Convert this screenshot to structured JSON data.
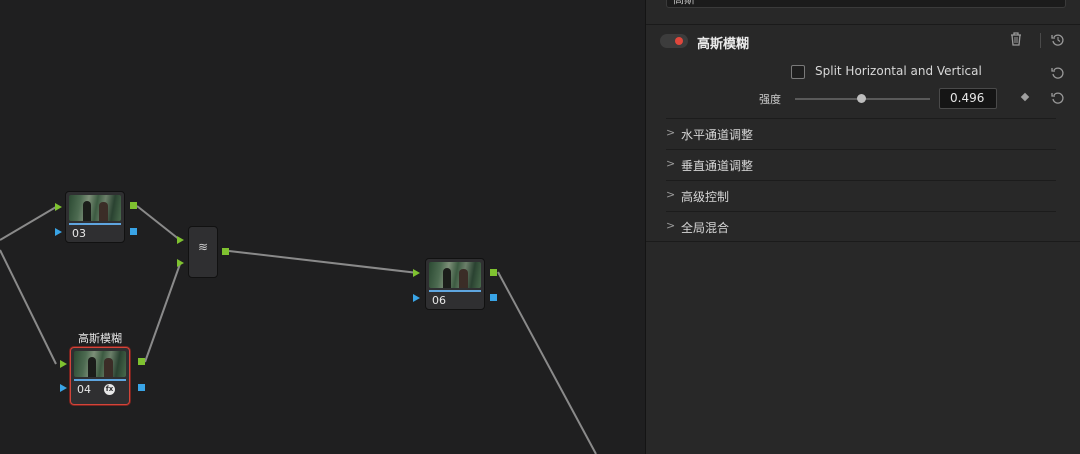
{
  "graph": {
    "nodes": [
      {
        "id": "03",
        "label": "03"
      },
      {
        "id": "04",
        "label": "04",
        "title": "高斯模糊",
        "fx_badge": "fx"
      },
      {
        "id": "06",
        "label": "06"
      }
    ],
    "mixer_glyph": "≋"
  },
  "inspector": {
    "search_value": "高斯",
    "search_clear": "✕",
    "effect_title": "高斯模糊",
    "effect_enabled": true,
    "checkbox_label": "Split Horizontal and Vertical",
    "checkbox_checked": false,
    "param_label": "强度",
    "param_value": "0.496",
    "param_fraction": 0.496,
    "sections": [
      {
        "label": "水平通道调整"
      },
      {
        "label": "垂直通道调整"
      },
      {
        "label": "高级控制"
      },
      {
        "label": "全局混合"
      }
    ],
    "icons": {
      "delete": "trash-icon",
      "reset": "reset-icon",
      "keyframe": "keyframe-diamond-icon",
      "chevron": "chevron-right-icon"
    }
  },
  "colors": {
    "accent_red": "#e0473c",
    "port_green": "#7fc230",
    "port_blue": "#39a4e6"
  }
}
